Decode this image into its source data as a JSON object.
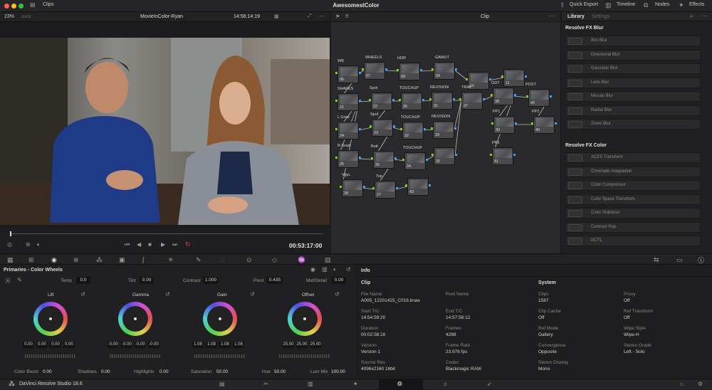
{
  "app_title": "AwesomestColor",
  "titlebar": {
    "clips_label": "Clips",
    "quick_export": "Quick Export",
    "timeline": "Timeline",
    "nodes": "Nodes",
    "effects": "Effects"
  },
  "viewer": {
    "zoom": "23%",
    "clip_name": "MovieInColor-Ryan",
    "timecode_top": "14:56:14:19",
    "playhead_timecode": "00:53:17:00"
  },
  "node_editor": {
    "mode": "Clip",
    "nodes": [
      {
        "label": "WB",
        "num": "06"
      },
      {
        "label": "WHEELS",
        "num": "07"
      },
      {
        "label": "HDR",
        "num": "08"
      },
      {
        "label": "GAMUT",
        "num": "09"
      },
      {
        "label": "",
        "num": "10"
      },
      {
        "label": "",
        "num": "11"
      },
      {
        "label": "SHAPES",
        "num": "21"
      },
      {
        "label": "Spot",
        "num": "22"
      },
      {
        "label": "TOUCHUP",
        "num": "30"
      },
      {
        "label": "REVISION",
        "num": "31"
      },
      {
        "label": "TRIM",
        "num": "37"
      },
      {
        "label": "ODT",
        "num": "38"
      },
      {
        "label": "POST",
        "num": "42"
      },
      {
        "label": "L Grad",
        "num": "24"
      },
      {
        "label": "Spot",
        "num": "23"
      },
      {
        "label": "TOUCHUP",
        "num": "32"
      },
      {
        "label": "REVISION",
        "num": "33"
      },
      {
        "label": "PP1",
        "num": "39"
      },
      {
        "label": "PP2",
        "num": "40"
      },
      {
        "label": "R Grad",
        "num": "25"
      },
      {
        "label": "Bott",
        "num": "26"
      },
      {
        "label": "TOUCHUP",
        "num": "34"
      },
      {
        "label": "",
        "num": "35"
      },
      {
        "label": "PP3",
        "num": "41"
      },
      {
        "label": "Vign.",
        "num": "28"
      },
      {
        "label": "Top",
        "num": "27"
      },
      {
        "label": "",
        "num": "43"
      }
    ]
  },
  "library": {
    "tab_library": "Library",
    "tab_settings": "Settings",
    "section_blur": "Resolve FX Blur",
    "blur_items": [
      "Box Blur",
      "Directional Blur",
      "Gaussian Blur",
      "Lens Blur",
      "Mosaic Blur",
      "Radial Blur",
      "Zoom Blur"
    ],
    "section_color": "Resolve FX Color",
    "color_items": [
      "ACES Transform",
      "Chromatic Adaptation",
      "Color Compressor",
      "Color Space Transform",
      "Color Stabilizer",
      "Contrast Pop",
      "DCTL"
    ]
  },
  "primaries": {
    "title": "Primaries - Color Wheels",
    "temp_label": "Temp",
    "temp": "0.0",
    "tint_label": "Tint",
    "tint": "0.00",
    "contrast_label": "Contrast",
    "contrast": "1.000",
    "pivot_label": "Pivot",
    "pivot": "0.435",
    "middetail_label": "Mid/Detail",
    "middetail": "0.00",
    "wheels": [
      {
        "name": "Lift",
        "values": [
          "0.00",
          "0.00",
          "0.00",
          "0.00"
        ]
      },
      {
        "name": "Gamma",
        "values": [
          "-0.00",
          "-0.00",
          "-0.00",
          "-0.00"
        ]
      },
      {
        "name": "Gain",
        "values": [
          "1.08",
          "1.08",
          "1.08",
          "1.08"
        ]
      },
      {
        "name": "Offset",
        "values": [
          "25.00",
          "25.00",
          "25.00"
        ]
      }
    ],
    "colorboost_label": "Color Boost",
    "colorboost": "0.00",
    "shadows_label": "Shadows",
    "shadows": "0.00",
    "highlights_label": "Highlights",
    "highlights": "0.00",
    "saturation_label": "Saturation",
    "saturation": "50.00",
    "hue_label": "Hue",
    "hue": "50.00",
    "lummix_label": "Lum Mix",
    "lummix": "100.00"
  },
  "info": {
    "title": "Info",
    "clip_heading": "Clip",
    "system_heading": "System",
    "clip_fields": [
      {
        "label": "File Name",
        "value": "A005_12201425_C016.braw"
      },
      {
        "label": "Reel Name",
        "value": ""
      },
      {
        "label": "Start T/C",
        "value": "14:54:59:20"
      },
      {
        "label": "End T/C",
        "value": "14:57:58:12"
      },
      {
        "label": "Duration",
        "value": "00:02:58:16"
      },
      {
        "label": "Frames",
        "value": "4288"
      },
      {
        "label": "Version",
        "value": "Version 1"
      },
      {
        "label": "Frame Rate",
        "value": "23.976 fps"
      },
      {
        "label": "Source Res",
        "value": "4096x2160 16bit"
      },
      {
        "label": "Codec",
        "value": "Blackmagic RAW"
      }
    ],
    "system_fields": [
      {
        "label": "Clips",
        "value": "1587"
      },
      {
        "label": "Proxy",
        "value": "Off"
      },
      {
        "label": "Clip Cache",
        "value": "Off"
      },
      {
        "label": "Ref Transform",
        "value": "Off"
      },
      {
        "label": "Ref Mode",
        "value": "Gallery"
      },
      {
        "label": "Wipe Style",
        "value": "Wipe-H"
      },
      {
        "label": "Convergence",
        "value": "Opposite"
      },
      {
        "label": "Stereo Grade",
        "value": "Left - Solo"
      },
      {
        "label": "Stereo Display",
        "value": "Mono"
      }
    ]
  },
  "bottombar": {
    "product": "DaVinci Resolve Studio 18.6"
  }
}
